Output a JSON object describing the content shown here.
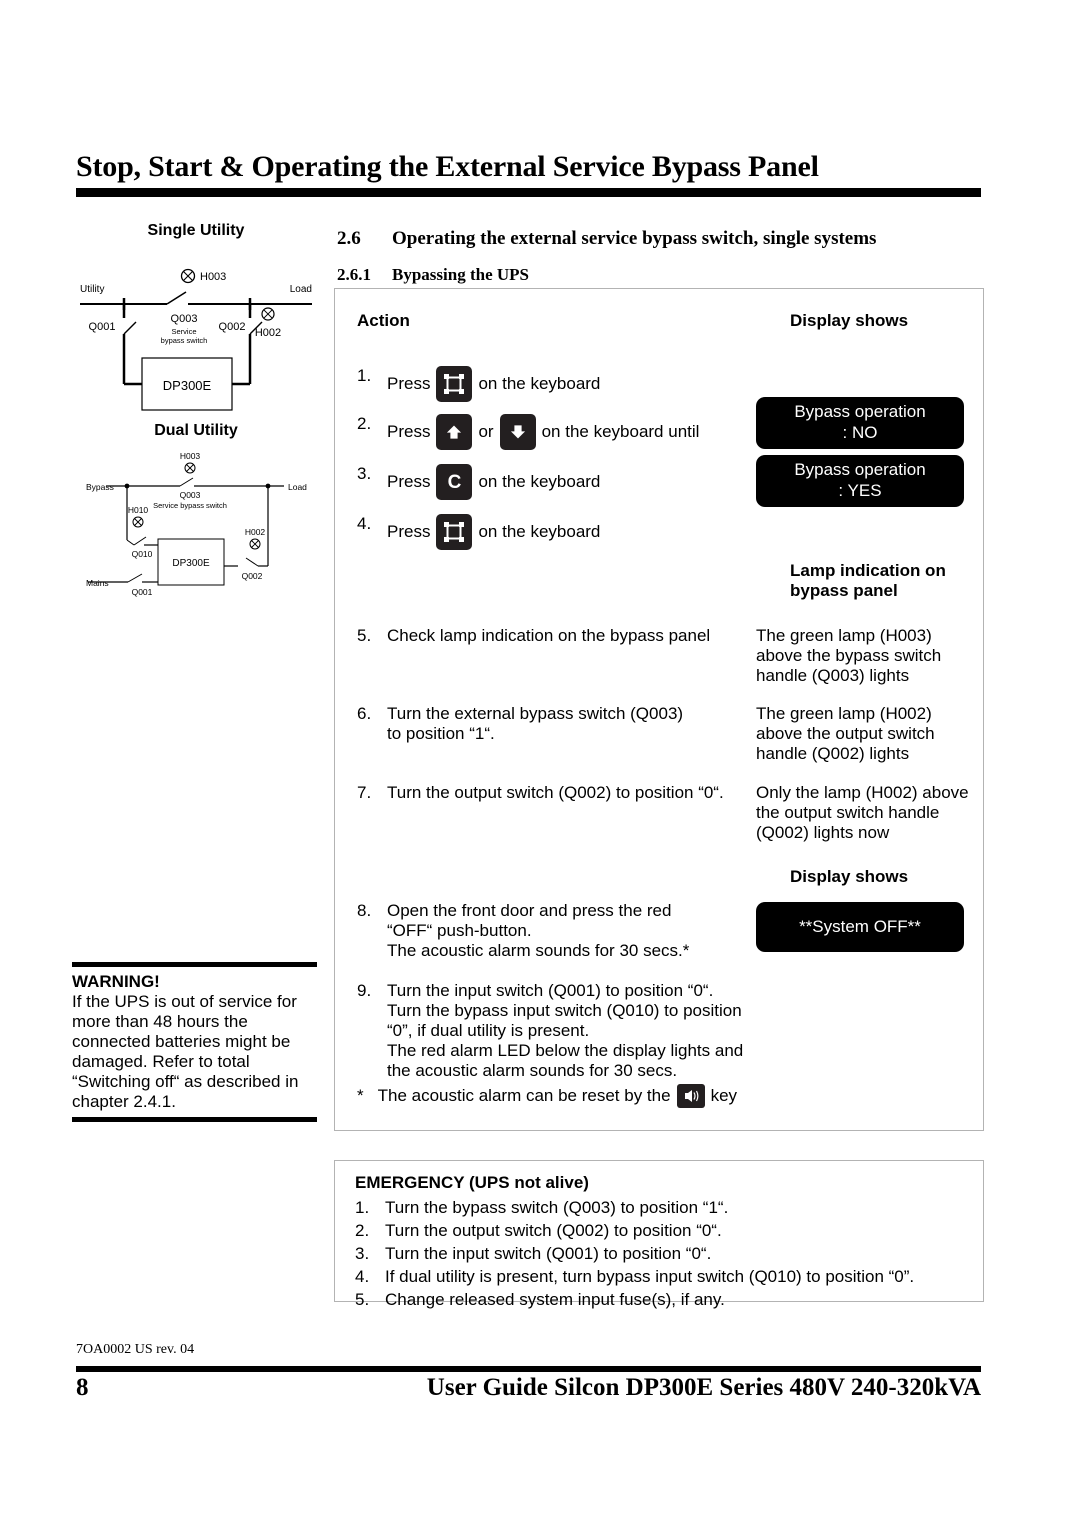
{
  "header": {
    "title": "Stop, Start & Operating the External Service Bypass Panel"
  },
  "sections": {
    "num_26": "2.6",
    "title_26": "Operating the external service bypass switch, single systems",
    "num_261": "2.6.1",
    "title_261": "Bypassing the UPS"
  },
  "diagrams": {
    "single": {
      "heading": "Single Utility",
      "labels": {
        "source": "Utility",
        "load": "Load",
        "lamp_top": "H003",
        "q001": "Q001",
        "q003": "Q003",
        "q003_sub1": "Service",
        "q003_sub2": "bypass switch",
        "q002": "Q002",
        "h002": "H002",
        "unit": "DP300E"
      }
    },
    "dual": {
      "heading": "Dual Utility",
      "labels": {
        "bypass": "Bypass",
        "load": "Load",
        "mains": "Mains",
        "h003": "H003",
        "q003": "Q003",
        "q003_sub": "Service bypass switch",
        "h010": "H010",
        "q010": "Q010",
        "h002": "H002",
        "q002": "Q002",
        "q001": "Q001",
        "unit": "DP300E"
      }
    }
  },
  "warning": {
    "title": "WARNING!",
    "body": "If the UPS is out of service for more than 48 hours the connected batteries might be damaged. Refer to total “Switching off“ as described in chapter 2.4.1."
  },
  "procedure": {
    "col_action": "Action",
    "col_display_1": "Display shows",
    "col_lamp": "Lamp indication on bypass panel",
    "col_display_2": "Display shows",
    "steps": [
      {
        "num": "1.",
        "pre": "Press",
        "key": "enter-frame-key",
        "post": "on the keyboard"
      },
      {
        "num": "2.",
        "pre": "Press",
        "key": "arrow-up-key",
        "mid": "or",
        "key2": "arrow-down-key",
        "post": "on the keyboard until"
      },
      {
        "num": "3.",
        "pre": "Press",
        "key": "c-key",
        "post": "on the keyboard"
      },
      {
        "num": "4.",
        "pre": "Press",
        "key": "enter-frame-key",
        "post": "on the keyboard"
      },
      {
        "num": "5.",
        "text": "Check lamp indication on the bypass panel"
      },
      {
        "num": "6.",
        "text": "Turn the external bypass switch (Q003)\nto position “1“."
      },
      {
        "num": "7.",
        "text": "Turn the output switch (Q002) to position “0“."
      },
      {
        "num": "8.",
        "text": "Open the front door and press the red\n“OFF“ push-button.\nThe acoustic alarm sounds for 30 secs.*"
      },
      {
        "num": "9.",
        "text": "Turn the input switch (Q001) to position “0“.\nTurn the bypass input switch (Q010) to position\n“0”, if dual utility is present.\nThe red alarm LED below the display lights and\nthe acoustic alarm sounds for 30 secs."
      }
    ],
    "displays": [
      {
        "line1": "Bypass operation",
        "line2": ": NO"
      },
      {
        "line1": "Bypass operation",
        "line2": ": YES"
      },
      {
        "line1": "**System OFF**",
        "line2": ""
      }
    ],
    "lamp_results": [
      "The green lamp (H003) above the bypass switch handle (Q003) lights",
      "The green lamp (H002) above the output switch handle (Q002) lights",
      "Only the lamp (H002) above the output switch handle (Q002) lights now"
    ],
    "footnote": {
      "marker": "*",
      "pre": "The acoustic alarm can be reset by the",
      "key": "alarm-buzzer-key",
      "post": "key"
    }
  },
  "emergency": {
    "title": "EMERGENCY (UPS not alive)",
    "items": [
      {
        "n": "1.",
        "t": "Turn the bypass switch (Q003) to position “1“."
      },
      {
        "n": "2.",
        "t": "Turn the output switch (Q002) to position “0“."
      },
      {
        "n": "3.",
        "t": "Turn the input switch (Q001) to position “0“."
      },
      {
        "n": "4.",
        "t": "If dual utility is present, turn bypass input switch (Q010) to position “0”."
      },
      {
        "n": "5.",
        "t": "Change released system input fuse(s), if any."
      }
    ]
  },
  "footer": {
    "doc_code": "7OA0002 US rev. 04",
    "page_number": "8",
    "guide_title": "User Guide Silcon DP300E Series 480V 240-320kVA"
  },
  "colors": {
    "ink": "#000000",
    "box_border": "#b3b3b3",
    "keycap": "#231f20",
    "lcd_bg": "#000000",
    "lcd_text": "#ffffff"
  }
}
